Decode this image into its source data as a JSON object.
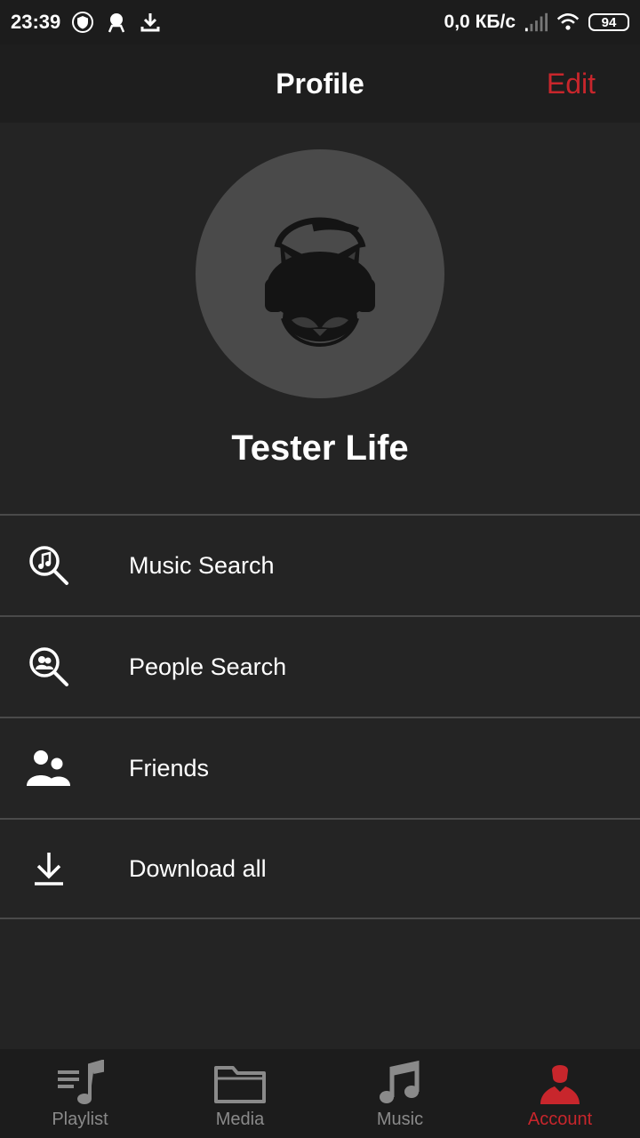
{
  "status_bar": {
    "time": "23:39",
    "speed": "0,0 КБ/с",
    "battery": "94"
  },
  "header": {
    "title": "Profile",
    "edit_label": "Edit"
  },
  "profile": {
    "name": "Tester Life"
  },
  "menu": [
    {
      "label": "Music Search",
      "icon": "music-search-icon"
    },
    {
      "label": "People Search",
      "icon": "people-search-icon"
    },
    {
      "label": "Friends",
      "icon": "friends-icon"
    },
    {
      "label": "Download all",
      "icon": "download-icon"
    }
  ],
  "bottom_nav": [
    {
      "label": "Playlist",
      "icon": "playlist-icon",
      "active": false
    },
    {
      "label": "Media",
      "icon": "folder-icon",
      "active": false
    },
    {
      "label": "Music",
      "icon": "music-note-icon",
      "active": false
    },
    {
      "label": "Account",
      "icon": "account-icon",
      "active": true
    }
  ],
  "colors": {
    "accent": "#c8262c",
    "background": "#242424",
    "header": "#1e1e1e",
    "inactive": "#8a8a8a"
  }
}
